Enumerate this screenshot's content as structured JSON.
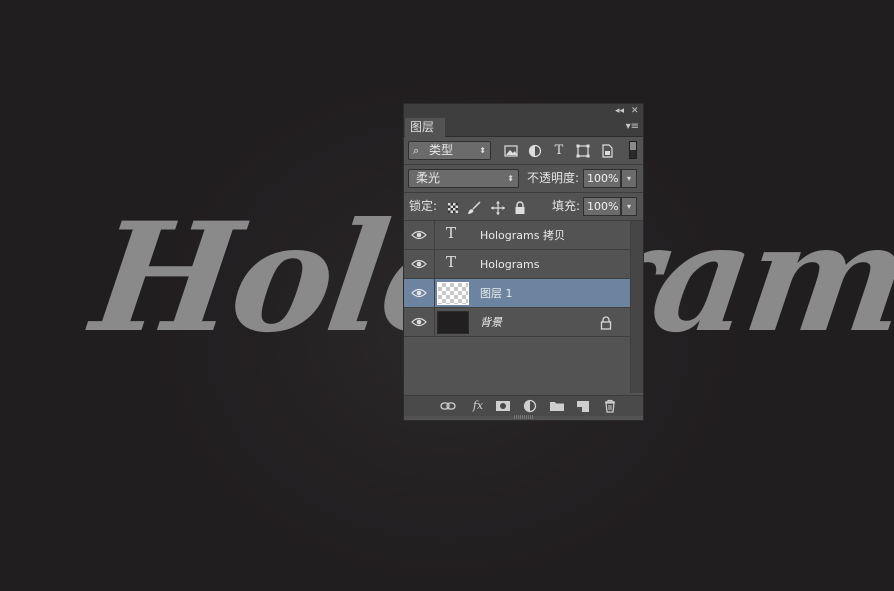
{
  "canvas": {
    "text": "Holograms",
    "text_color": "#8a8a8a",
    "background": "#221f21"
  },
  "panel": {
    "collapse_icon": "double-chevron-left-icon",
    "close_icon": "close-icon",
    "tab": "图层",
    "menu_icon": "panel-menu-icon",
    "filter": {
      "icon": "search-icon",
      "value": "类型",
      "icons": [
        "image-filter-icon",
        "adjustment-filter-icon",
        "type-filter-icon",
        "shape-filter-icon",
        "smart-object-filter-icon"
      ],
      "toggle": "filter-toggle-icon"
    },
    "blend_mode": "柔光",
    "opacity_label": "不透明度:",
    "opacity_value": "100%",
    "lock_label": "锁定:",
    "lock_icons": [
      "lock-transparent-icon",
      "lock-paint-icon",
      "lock-position-icon",
      "lock-all-icon"
    ],
    "fill_label": "填充:",
    "fill_value": "100%",
    "layers": [
      {
        "name": "Holograms 拷贝",
        "kind": "type",
        "visible": true,
        "selected": false
      },
      {
        "name": "Holograms",
        "kind": "type",
        "visible": true,
        "selected": false
      },
      {
        "name": "图层 1",
        "kind": "pixel",
        "visible": true,
        "selected": true
      },
      {
        "name": "背景",
        "kind": "background",
        "visible": true,
        "selected": false,
        "locked": true
      }
    ],
    "selection_color": "#6d84a0",
    "footer_icons": [
      "link-layers-icon",
      "fx-icon",
      "add-mask-icon",
      "new-adjustment-icon",
      "new-group-icon",
      "new-layer-icon",
      "delete-layer-icon"
    ],
    "fx_label": "fx"
  }
}
